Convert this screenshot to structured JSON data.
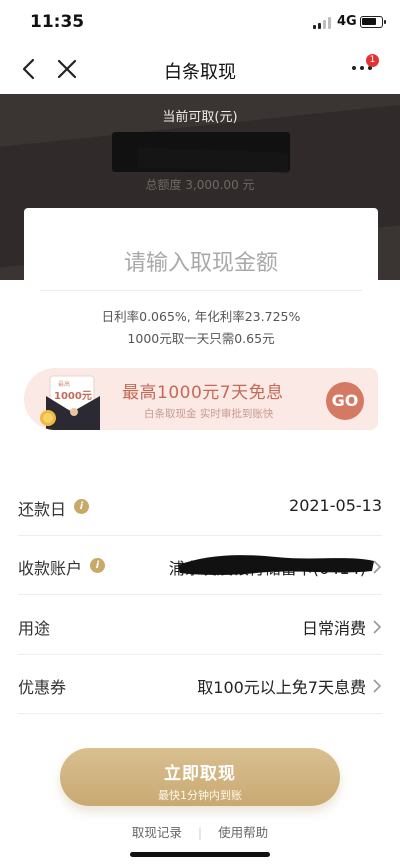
{
  "status_bar": {
    "time": "11:35",
    "network": "4G"
  },
  "nav": {
    "title": "白条取现",
    "badge": "1"
  },
  "hero": {
    "available_label": "当前可取(元)",
    "credit_line": "总额度 3,000.00 元"
  },
  "card": {
    "amount_placeholder": "请输入取现金额",
    "daily_rate": "日利率0.065%, 年化利率23.725%",
    "cost_example": "1000元取一天只需0.65元"
  },
  "promo": {
    "envelope_label": "1000元",
    "envelope_small": "最高",
    "title": "最高1000元7天免息",
    "subtitle": "白条取现金 实时审批到账快",
    "go_label": "GO"
  },
  "form": {
    "rows": [
      {
        "label": "还款日",
        "value": "2021-05-13"
      },
      {
        "label": "收款账户",
        "value": "浦东发展银行储蓄卡(6414)"
      },
      {
        "label": "用途",
        "value": "日常消费"
      },
      {
        "label": "优惠券",
        "value": "取100元以上免7天息费"
      }
    ]
  },
  "cta": {
    "title": "立即取现",
    "subtitle": "最快1分钟内到账"
  },
  "footer": {
    "records": "取现记录",
    "help": "使用帮助",
    "separator": "|"
  },
  "colors": {
    "accent_gold": "#c9a972",
    "promo_pink": "#fbe9e5",
    "hero_dark": "#3a3532",
    "badge_red": "#e23232"
  }
}
